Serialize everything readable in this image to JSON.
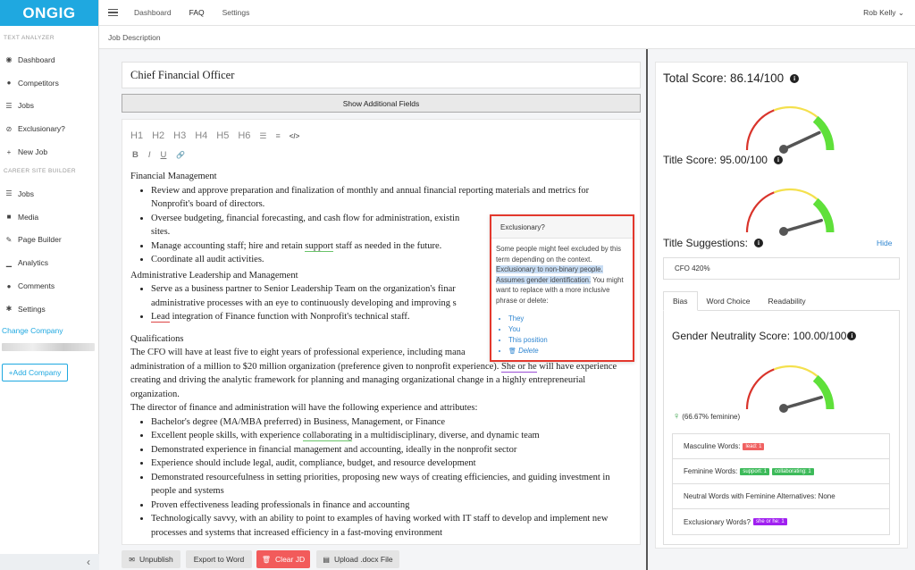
{
  "logo": "ONGIG",
  "sidebar": {
    "section_text_analyzer": "TEXT ANALYZER",
    "items_top": [
      {
        "label": "Dashboard",
        "icon": "dashboard-icon",
        "glyph": "◉"
      },
      {
        "label": "Competitors",
        "icon": "users-icon",
        "glyph": "●"
      },
      {
        "label": "Jobs",
        "icon": "list-icon",
        "glyph": "☰"
      },
      {
        "label": "Exclusionary?",
        "icon": "ban-icon",
        "glyph": "⊘"
      },
      {
        "label": "New Job",
        "icon": "plus-icon",
        "glyph": "+"
      }
    ],
    "section_career_site": "CAREER SITE BUILDER",
    "items_bottom": [
      {
        "label": "Jobs",
        "icon": "list-icon",
        "glyph": "☰"
      },
      {
        "label": "Media",
        "icon": "video-icon",
        "glyph": "■"
      },
      {
        "label": "Page Builder",
        "icon": "wrench-icon",
        "glyph": "✎"
      },
      {
        "label": "Analytics",
        "icon": "chart-icon",
        "glyph": "▁"
      },
      {
        "label": "Comments",
        "icon": "comment-icon",
        "glyph": "●"
      },
      {
        "label": "Settings",
        "icon": "gear-icon",
        "glyph": "✱"
      }
    ],
    "change_company": "Change Company",
    "add_company": "+Add Company",
    "collapse_glyph": "‹"
  },
  "topbar": {
    "nav": [
      "Dashboard",
      "FAQ",
      "Settings"
    ],
    "user": "Rob Kelly ⌄"
  },
  "breadcrumb": "Job Description",
  "editor": {
    "title": "Chief Financial Officer",
    "show_fields": "Show Additional Fields",
    "toolbar_headings": [
      "H1",
      "H2",
      "H3",
      "H4",
      "H5",
      "H6"
    ],
    "toolbar_bullet_glyph": "☰",
    "toolbar_numbered_glyph": "≡",
    "toolbar_code_glyph": "</>",
    "toolbar_format": [
      "B",
      "I",
      "U",
      "🔗"
    ],
    "h_financial": "Financial Management",
    "fm_1": "Review and approve preparation and finalization of monthly and annual financial reporting materials and metrics for Nonprofit's board of directors.",
    "fm_2": "Oversee budgeting, financial forecasting, and cash flow for administration, existin",
    "fm_2b": "sites.",
    "fm_3a": "Manage accounting staff; hire and retain ",
    "fm_3w": "support",
    "fm_3b": " staff as needed in the future.",
    "fm_4": "Coordinate all audit activities.",
    "h_admin": "Administrative Leadership and Management",
    "al_1a": "Serve as a business partner to Senior Leadership Team on the organization's finar",
    "al_1b": "administrative processes with an eye to continuously developing and improving s",
    "al_2w": "Lead",
    "al_2b": " integration of Finance function with Nonprofit's technical staff.",
    "h_qual": "Qualifications",
    "q_p1a": "The CFO will have at least five to eight years of professional experience, including mana",
    "q_p1b": "administration of a million to $20 million organization (preference given to nonprofit experience). ",
    "q_p1w": "She or he",
    "q_p1c": " will have experience creating and driving the analytic framework for planning and managing organizational change in a highly entrepreneurial organization.",
    "q_p2": "The director of finance and administration will have the following experience and attributes:",
    "q_1": "Bachelor's degree (MA/MBA preferred) in Business, Management, or Finance",
    "q_2a": "Excellent people skills, with experience ",
    "q_2w": "collaborating",
    "q_2b": " in a multidisciplinary, diverse, and dynamic team",
    "q_3": "Demonstrated experience in financial management and accounting, ideally in the nonprofit sector",
    "q_4": "Experience should include legal, audit, compliance, budget, and resource development",
    "q_5": "Demonstrated resourcefulness in setting priorities, proposing new ways of creating efficiencies, and guiding investment in people and systems",
    "q_6": "Proven effectiveness leading professionals in finance and accounting",
    "q_7": "Technologically savvy, with an ability to point to examples of having worked with IT staff to develop and implement new processes and systems that increased efficiency in a fast-moving environment"
  },
  "popup": {
    "title": "Exclusionary?",
    "text1": "Some people might feel excluded by this term depending on the context.",
    "highlight": "Exclusionary to non-binary people. Assumes gender identification.",
    "text2": "You might want to replace with a more inclusive phrase or delete:",
    "options": [
      "They",
      "You",
      "This position"
    ],
    "delete_label": "Delete",
    "trash_glyph": "🗑"
  },
  "buttons": {
    "unpublish": "Unpublish",
    "export": "Export to Word",
    "clear": "Clear JD",
    "upload": "Upload .docx File",
    "unpublish_glyph": "✉",
    "export_glyph": "",
    "clear_glyph": "🗑",
    "upload_glyph": "▤"
  },
  "scores": {
    "total_label": "Total Score: 86.14/100",
    "total_value": 86.14,
    "title_label": "Title Score: 95.00/100",
    "title_value": 95.0,
    "suggestions_label": "Title Suggestions:",
    "hide": "Hide",
    "suggestion": "CFO 420%",
    "tabs": [
      "Bias",
      "Word Choice",
      "Readability"
    ],
    "gender_label": "Gender Neutrality Score: 100.00/100",
    "gender_value": 100.0,
    "feminine_pct": "(66.67% feminine)",
    "info_glyph": "i",
    "female_glyph": "♀",
    "masculine_label": "Masculine Words:",
    "masculine_badges": [
      "lead: 1"
    ],
    "feminine_label": "Feminine Words:",
    "feminine_badges": [
      "support: 1",
      "collaborating: 1"
    ],
    "neutral_label": "Neutral Words with Feminine Alternatives:  None",
    "exclusionary_label": "Exclusionary Words?",
    "exclusionary_badges": [
      "she or he: 1"
    ]
  },
  "colors": {
    "brand": "#1fa8e0",
    "gauge_red": "#d9342b",
    "gauge_yellow": "#f4e04d",
    "gauge_green": "#5fe03a",
    "needle": "#555555",
    "popup_border": "#e3382d"
  }
}
